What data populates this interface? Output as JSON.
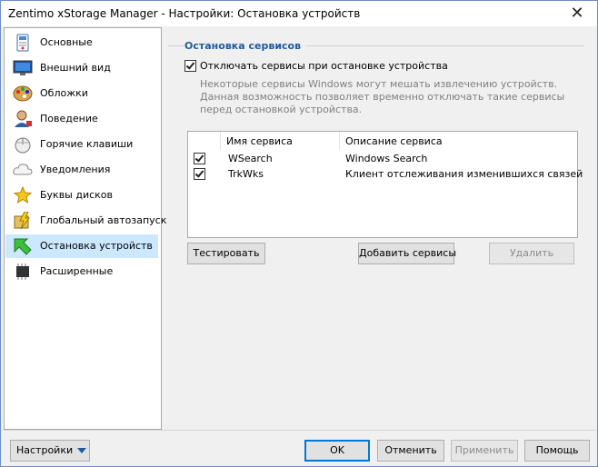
{
  "window": {
    "title": "Zentimo xStorage Manager - Настройки: Остановка устройств",
    "close_glyph": "✕"
  },
  "sidebar": {
    "items": [
      {
        "label": "Основные",
        "icon": "general-settings-icon"
      },
      {
        "label": "Внешний вид",
        "icon": "monitor-icon"
      },
      {
        "label": "Обложки",
        "icon": "palette-icon"
      },
      {
        "label": "Поведение",
        "icon": "user-behavior-icon"
      },
      {
        "label": "Горячие клавиши",
        "icon": "mouse-hotkey-icon"
      },
      {
        "label": "Уведомления",
        "icon": "cloud-notification-icon"
      },
      {
        "label": "Буквы дисков",
        "icon": "star-drive-letter-icon"
      },
      {
        "label": "Глобальный автозапуск",
        "icon": "lightning-autorun-icon"
      },
      {
        "label": "Остановка устройств",
        "icon": "green-arrow-icon",
        "selected": true
      },
      {
        "label": "Расширенные",
        "icon": "chip-icon"
      }
    ]
  },
  "main": {
    "section_title": "Остановка сервисов",
    "stop_services_checkbox": {
      "label": "Отключать сервисы при остановке устройства",
      "checked": true
    },
    "description": "Некоторые сервисы Windows могут мешать извлечению устройств. Данная возможность позволяет временно отключать такие сервисы перед остановкой устройства.",
    "services_table": {
      "columns": [
        "Имя сервиса",
        "Описание сервиса"
      ],
      "rows": [
        {
          "checked": true,
          "name": "WSearch",
          "description": "Windows Search"
        },
        {
          "checked": true,
          "name": "TrkWks",
          "description": "Клиент отслеживания изменившихся связей"
        }
      ]
    },
    "buttons": {
      "test": "Тестировать",
      "add": "Добавить сервисы",
      "delete": "Удалить"
    }
  },
  "footer": {
    "settings_menu": "Настройки",
    "ok": "OK",
    "cancel": "Отменить",
    "apply": "Применить",
    "help": "Помощь"
  },
  "colors": {
    "accent": "#1f5a9e",
    "selection": "#cce8ff",
    "disabled_text": "#8c8c8c"
  }
}
